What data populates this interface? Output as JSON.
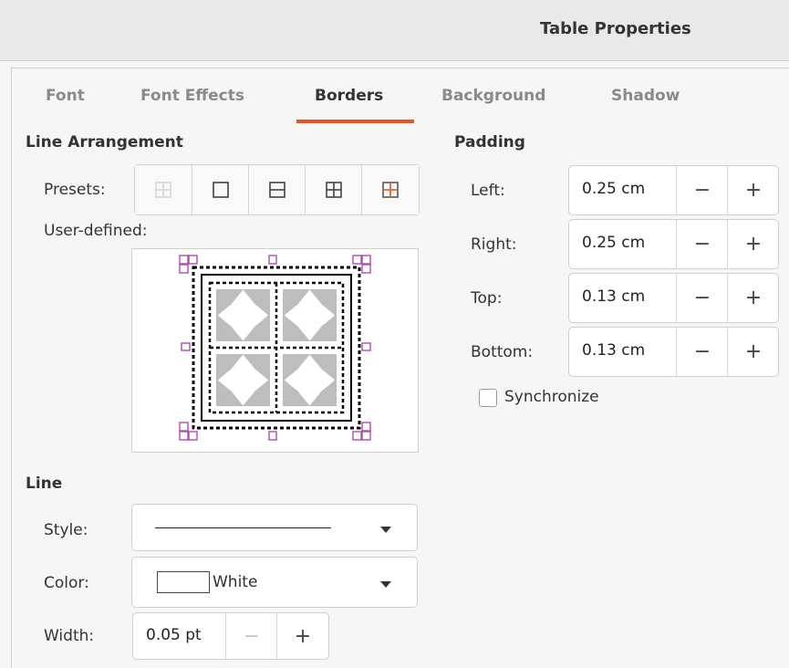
{
  "window": {
    "title": "Table Properties"
  },
  "tabs": [
    {
      "label": "Font",
      "active": false,
      "enabled": true
    },
    {
      "label": "Font Effects",
      "active": false,
      "enabled": true
    },
    {
      "label": "Borders",
      "active": true,
      "enabled": true
    },
    {
      "label": "Background",
      "active": false,
      "enabled": true
    },
    {
      "label": "Shadow",
      "active": false,
      "enabled": true
    }
  ],
  "accent_color": "#e95420",
  "line_arrangement": {
    "heading": "Line Arrangement",
    "presets_label": "Presets:",
    "presets": [
      {
        "icon": "no-borders-icon"
      },
      {
        "icon": "outer-border-only-icon"
      },
      {
        "icon": "outer-border-horizontal-lines-icon"
      },
      {
        "icon": "outer-border-all-inner-lines-icon"
      },
      {
        "icon": "outer-border-keep-inner-lines-icon"
      }
    ],
    "user_defined_label": "User-defined:"
  },
  "line": {
    "heading": "Line",
    "style_label": "Style:",
    "style_value": "solid",
    "color_label": "Color:",
    "color_value": "White",
    "color_swatch": "#ffffff",
    "width_label": "Width:",
    "width_value": "0.05 pt"
  },
  "padding": {
    "heading": "Padding",
    "left_label": "Left:",
    "left_value": "0.25 cm",
    "right_label": "Right:",
    "right_value": "0.25 cm",
    "top_label": "Top:",
    "top_value": "0.13 cm",
    "bottom_label": "Bottom:",
    "bottom_value": "0.13 cm",
    "minus_symbol": "−",
    "plus_symbol": "+",
    "synchronize_label": "Synchronize",
    "synchronize_checked": false
  }
}
